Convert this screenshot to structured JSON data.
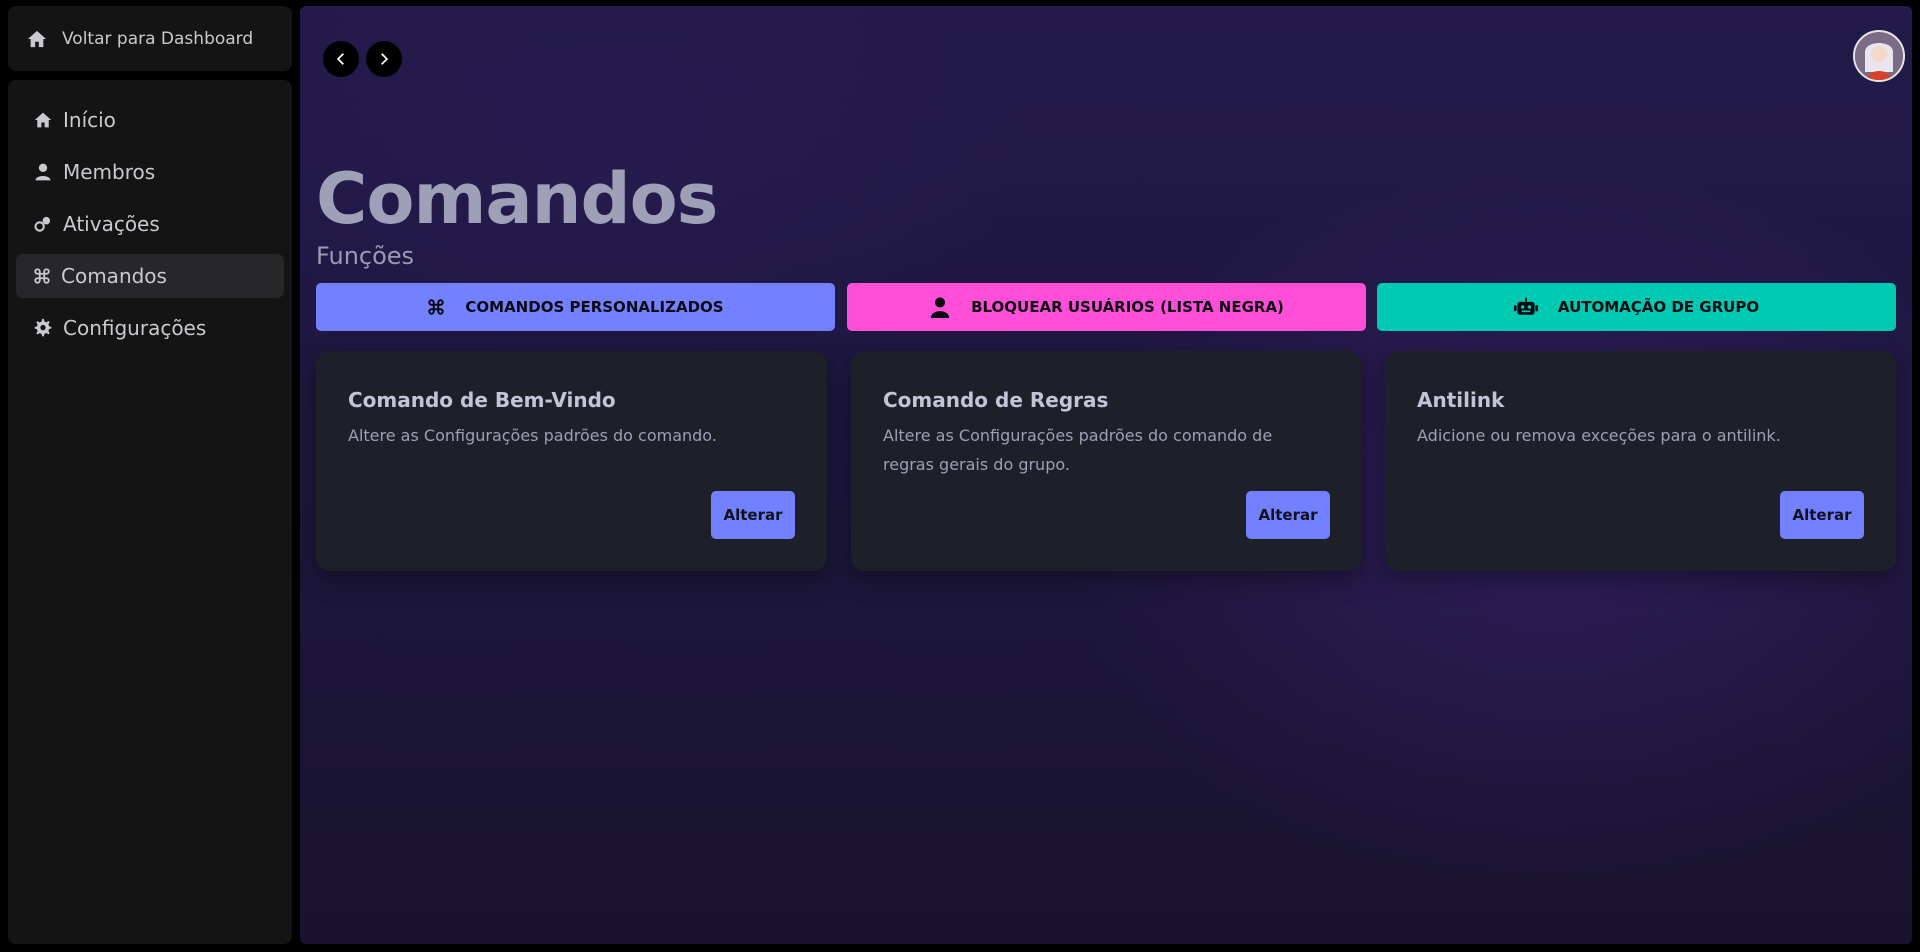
{
  "sidebar": {
    "back": {
      "label": "Voltar para Dashboard",
      "icon": "home-icon"
    },
    "items": [
      {
        "label": "Início",
        "icon": "home-icon"
      },
      {
        "label": "Membros",
        "icon": "user-icon"
      },
      {
        "label": "Ativações",
        "icon": "toggle-icon"
      },
      {
        "label": "Comandos",
        "icon": "command-icon",
        "active": true
      },
      {
        "label": "Configurações",
        "icon": "gear-icon"
      }
    ]
  },
  "header": {
    "title": "Comandos",
    "section": "Funções"
  },
  "functions": [
    {
      "label": "COMANDOS PERSONALIZADOS",
      "icon": "command-icon",
      "color": "#7380ff"
    },
    {
      "label": "BLOQUEAR USUÁRIOS (LISTA NEGRA)",
      "icon": "user-icon",
      "color": "#ff4fd8"
    },
    {
      "label": "AUTOMAÇÃO DE GRUPO",
      "icon": "robot-icon",
      "color": "#00c9b1"
    }
  ],
  "cards": [
    {
      "title": "Comando de Bem-Vindo",
      "description": "Altere as Configurações padrões do comando.",
      "button": "Alterar"
    },
    {
      "title": "Comando de Regras",
      "description": "Altere as Configurações padrões do comando de regras gerais do grupo.",
      "button": "Alterar"
    },
    {
      "title": "Antilink",
      "description": "Adicione ou remova exceções para o antilink.",
      "button": "Alterar"
    }
  ],
  "colors": {
    "accent": "#7380ff",
    "pink": "#ff4fd8",
    "teal": "#00c9b1"
  }
}
